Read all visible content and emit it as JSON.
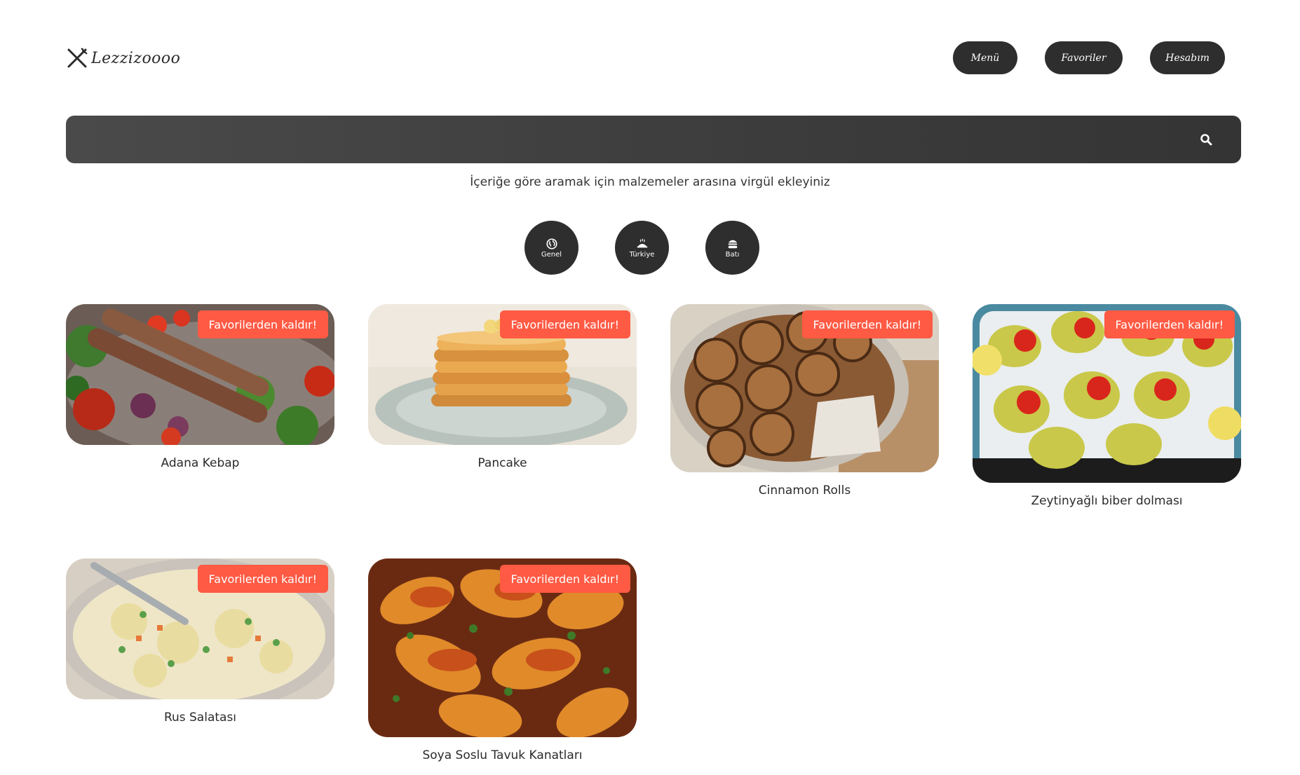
{
  "header": {
    "logo_text": "Lezzizoooo",
    "nav": [
      "Menü",
      "Favoriler",
      "Hesabım"
    ]
  },
  "search": {
    "placeholder": "",
    "hint": "İçeriğe göre aramak için malzemeler arasına virgül ekleyiniz"
  },
  "categories": [
    {
      "label": "Genel",
      "icon": "globe-icon"
    },
    {
      "label": "Türkiye",
      "icon": "turkey-food-icon"
    },
    {
      "label": "Batı",
      "icon": "burger-icon"
    }
  ],
  "favorites": [
    {
      "title": "Adana Kebap",
      "button": "Favorilerden kaldır!"
    },
    {
      "title": "Pancake",
      "button": "Favorilerden kaldır!"
    },
    {
      "title": "Cinnamon Rolls",
      "button": "Favorilerden kaldır!"
    },
    {
      "title": "Zeytinyağlı biber dolması",
      "button": "Favorilerden kaldır!"
    },
    {
      "title": "Rus Salatası",
      "button": "Favorilerden kaldır!"
    },
    {
      "title": "Soya Soslu Tavuk Kanatları",
      "button": "Favorilerden kaldır!"
    }
  ],
  "colors": {
    "dark": "#2e2e2e",
    "accent": "#ff5a44"
  }
}
